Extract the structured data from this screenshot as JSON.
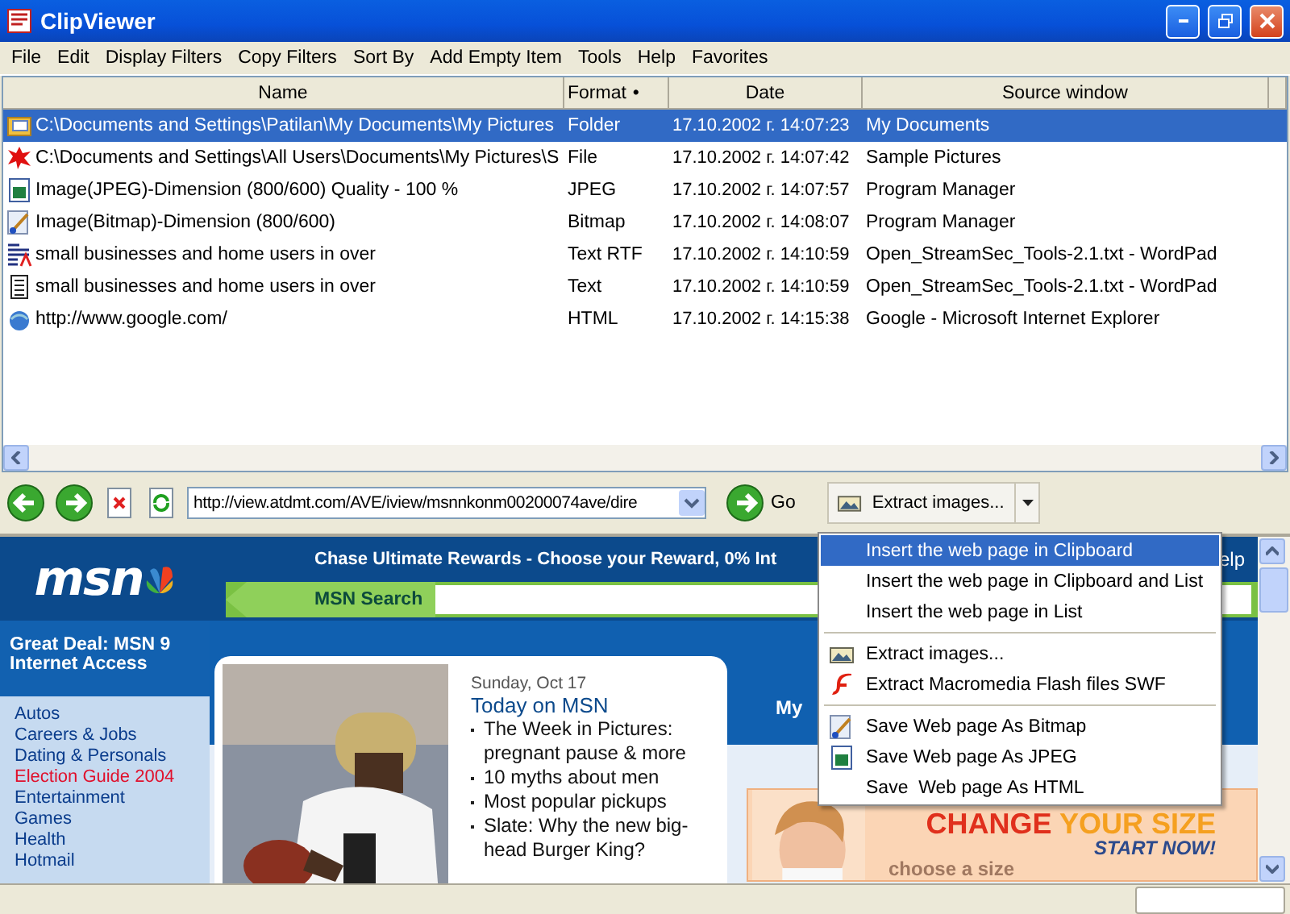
{
  "window": {
    "title": "ClipViewer"
  },
  "menu_bar": [
    "File",
    "Edit",
    "Display Filters",
    "Copy Filters",
    "Sort By",
    "Add Empty Item",
    "Tools",
    "Help",
    "Favorites"
  ],
  "table": {
    "columns": [
      {
        "label": "Name"
      },
      {
        "label": "Format",
        "sort_mark": "•"
      },
      {
        "label": "Date"
      },
      {
        "label": "Source window"
      }
    ],
    "rows": [
      {
        "kind": "folder",
        "name": "C:\\Documents and Settings\\Patilan\\My Documents\\My Pictures",
        "format": "Folder",
        "date": "17.10.2002 г. 14:07:23",
        "source": "My Documents",
        "selected": true
      },
      {
        "kind": "file",
        "name": "C:\\Documents and Settings\\All Users\\Documents\\My Pictures\\S",
        "format": "File",
        "date": "17.10.2002 г. 14:07:42",
        "source": "Sample Pictures",
        "selected": false
      },
      {
        "kind": "jpeg",
        "name": "Image(JPEG)-Dimension (800/600) Quality - 100 %",
        "format": "JPEG",
        "date": "17.10.2002 г. 14:07:57",
        "source": "Program Manager",
        "selected": false
      },
      {
        "kind": "bitmap",
        "name": "Image(Bitmap)-Dimension (800/600)",
        "format": "Bitmap",
        "date": "17.10.2002 г. 14:08:07",
        "source": "Program Manager",
        "selected": false
      },
      {
        "kind": "rtf",
        "name": "small businesses and home users in over",
        "format": "Text RTF",
        "date": "17.10.2002 г. 14:10:59",
        "source": "Open_StreamSec_Tools-2.1.txt - WordPad",
        "selected": false
      },
      {
        "kind": "text",
        "name": "small businesses and home users in over",
        "format": "Text",
        "date": "17.10.2002 г. 14:10:59",
        "source": "Open_StreamSec_Tools-2.1.txt - WordPad",
        "selected": false
      },
      {
        "kind": "html",
        "name": "http://www.google.com/",
        "format": "HTML",
        "date": "17.10.2002 г. 14:15:38",
        "source": "Google - Microsoft Internet Explorer",
        "selected": false
      }
    ]
  },
  "toolbar": {
    "url": "http://view.atdmt.com/AVE/iview/msnnkonm00200074ave/dire",
    "go_label": "Go",
    "action": "Extract images..."
  },
  "dropdown_menu": [
    {
      "kind": "plain",
      "label": "Insert the web page in Clipboard",
      "selected": true
    },
    {
      "kind": "plain",
      "label": "Insert the web page in Clipboard and List",
      "selected": false
    },
    {
      "kind": "plain",
      "label": "Insert the web page in List",
      "selected": false
    },
    {
      "kind": "separator"
    },
    {
      "kind": "images",
      "label": "Extract images...",
      "selected": false
    },
    {
      "kind": "flash",
      "label": "Extract Macromedia Flash files SWF",
      "selected": false
    },
    {
      "kind": "separator"
    },
    {
      "kind": "bitmap",
      "label": "Save Web page As Bitmap",
      "selected": false
    },
    {
      "kind": "jpeg",
      "label": "Save Web page As JPEG",
      "selected": false
    },
    {
      "kind": "plain",
      "label": "Save  Web page As HTML",
      "selected": false
    }
  ],
  "web_page": {
    "logo": "msn",
    "banner": "Chase Ultimate Rewards - Choose your Reward, 0% Int",
    "banner_right": "elp",
    "search_label": "MSN Search",
    "promo": "Great Deal: MSN 9 Internet Access",
    "links": [
      {
        "label": "Autos",
        "highlighted": false
      },
      {
        "label": "Careers & Jobs",
        "highlighted": false
      },
      {
        "label": "Dating & Personals",
        "highlighted": false
      },
      {
        "label": "Election Guide 2004",
        "highlighted": true
      },
      {
        "label": "Entertainment",
        "highlighted": false
      },
      {
        "label": "Games",
        "highlighted": false
      },
      {
        "label": "Health",
        "highlighted": false
      },
      {
        "label": "Hotmail",
        "highlighted": false
      }
    ],
    "date": "Sunday, Oct 17",
    "headline": "Today on MSN",
    "stories": [
      "The Week in Pictures: pregnant pause & more",
      "10 myths about men",
      "Most popular pickups",
      "Slate: Why the new big-head Burger King?"
    ],
    "tab_label": "My",
    "ad": {
      "headline_1": "CHANGE",
      "headline_2": "YOUR SIZE",
      "cta": "START NOW!",
      "subtitle": "choose a size"
    }
  }
}
